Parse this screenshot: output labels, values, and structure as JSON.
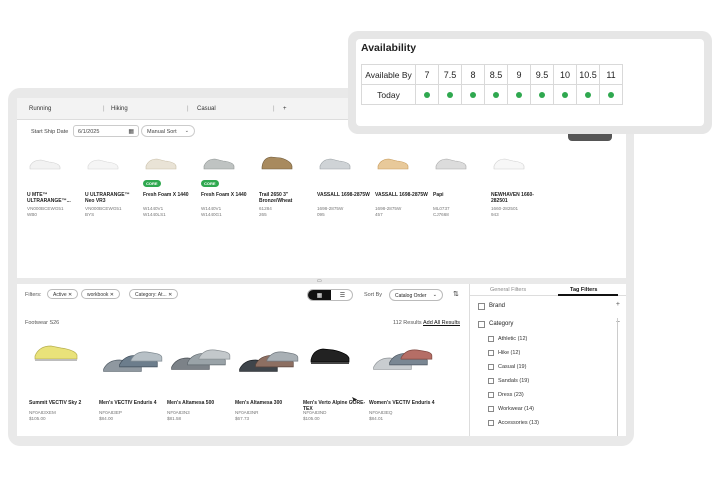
{
  "tabs": [
    {
      "label": "Running"
    },
    {
      "label": "Hiking"
    },
    {
      "label": "Casual"
    }
  ],
  "add_tab_label": "+",
  "controls": {
    "ship_date_label": "Start Ship Date",
    "ship_date_value": "6/1/2025",
    "sort_value": "Manual Sort"
  },
  "top_products": [
    {
      "name": "U MTE™ ULTRARANGE™...",
      "sku": "VN000BCEWG51",
      "sku2": "WB0",
      "badge": ""
    },
    {
      "name": "U ULTRARANGE™ Neo VR3",
      "sku": "VN000BCEWG51",
      "sku2": "BYS",
      "badge": ""
    },
    {
      "name": "Fresh Foam X 1440",
      "sku": "W1440V1",
      "sku2": "W1440LS1",
      "badge": "CORE"
    },
    {
      "name": "Fresh Foam X 1440",
      "sku": "W1440V1",
      "sku2": "W1440G1",
      "badge": "CORE"
    },
    {
      "name": "Trail 2650 3\" Bronze/Wheat",
      "sku": "61284",
      "sku2": "265",
      "badge": ""
    },
    {
      "name": "VASSALL 1698-2875W",
      "sku": "1698-2875W",
      "sku2": "095",
      "badge": ""
    },
    {
      "name": "VASSALL 1698-2875W",
      "sku": "1698-2875W",
      "sku2": "457",
      "badge": ""
    },
    {
      "name": "Papi",
      "sku": "ML0737",
      "sku2": "CJ7668",
      "badge": ""
    },
    {
      "name": "NEWHAVEN 1660-282501",
      "sku": "1660-282501",
      "sku2": "943",
      "badge": ""
    }
  ],
  "filters": {
    "label": "Filters:",
    "chips": [
      "Active",
      "workbook",
      "Category: At..."
    ]
  },
  "sort_by": {
    "label": "Sort By",
    "value": "Catalog Order"
  },
  "results": {
    "category": "Footwear S26",
    "count": "112 Results",
    "add_all": "Add All Results"
  },
  "bottom_products": [
    {
      "name": "Summit VECTIV Sky 2",
      "sku": "NF0A83XEM",
      "price": "$105.00"
    },
    {
      "name": "Men's VECTIV Enduris 4",
      "sku": "NF0A83EP",
      "price": "$84.00"
    },
    {
      "name": "Men's Altamesa 500",
      "sku": "NF0A83N3",
      "price": "$81.58"
    },
    {
      "name": "Men's Altamesa 300",
      "sku": "NF0A83NR",
      "price": "$67.73"
    },
    {
      "name": "Men's Verto Alpine GORE-TEX",
      "sku": "NF0A83ND",
      "price": "$105.00"
    },
    {
      "name": "Women's VECTIV Enduris 4",
      "sku": "NF0A83EQ",
      "price": "$84.01"
    }
  ],
  "panel": {
    "tabs": [
      "General Filters",
      "Tag Filters"
    ],
    "sections": [
      {
        "label": "Brand",
        "toggle": "+"
      },
      {
        "label": "Category",
        "toggle": "−"
      }
    ],
    "category_items": [
      "Athletic (12)",
      "Hike (12)",
      "Casual (19)",
      "Sandals (19)",
      "Dress (23)",
      "Workwear (14)",
      "Accessories (13)"
    ]
  },
  "availability": {
    "title": "Availability",
    "row_header": "Available By",
    "row_label": "Today",
    "sizes": [
      "7",
      "7.5",
      "8",
      "8.5",
      "9",
      "9.5",
      "10",
      "10.5",
      "11"
    ],
    "dot_color": "#2fa84f"
  },
  "colors": {
    "accent_green": "#2fa84f",
    "toggle_dark": "#111111"
  }
}
